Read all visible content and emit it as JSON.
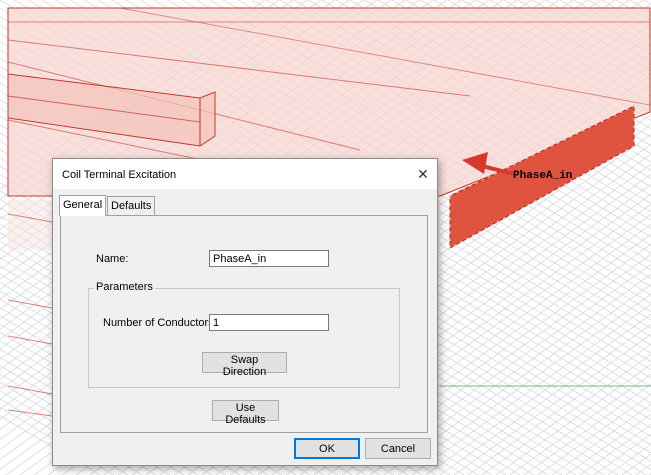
{
  "viewport": {
    "arrow_label": "PhaseA_in",
    "colors": {
      "face": "#f8d6d0",
      "edge": "#c0392b",
      "terminal": "#e0533f",
      "grid": "#c9ced6",
      "arrow": "#d63a2e"
    }
  },
  "dialog": {
    "title": "Coil Terminal Excitation",
    "close_icon": "close-icon",
    "tabs": [
      {
        "label": "General",
        "active": true
      },
      {
        "label": "Defaults",
        "active": false
      }
    ],
    "name_label": "Name:",
    "name_value": "PhaseA_in",
    "parameters_title": "Parameters",
    "conductors_label": "Number of Conductors:",
    "conductors_value": "1",
    "swap_button": "Swap Direction",
    "defaults_button": "Use Defaults",
    "ok_button": "OK",
    "cancel_button": "Cancel"
  }
}
